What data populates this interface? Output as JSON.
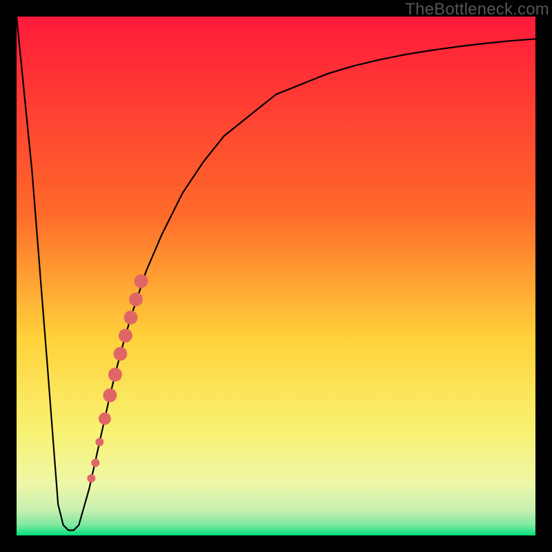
{
  "watermark": "TheBottleneck.com",
  "colors": {
    "frame": "#000000",
    "curve": "#000000",
    "marker": "#e06666",
    "top": "#ff1a3a",
    "mid1": "#ff6a2a",
    "mid2": "#ffd23a",
    "mid3": "#f8f272",
    "mid4": "#eef7a8",
    "bottom": "#00e07a"
  },
  "chart_data": {
    "type": "line",
    "title": "",
    "xlabel": "",
    "ylabel": "",
    "xlim": [
      0,
      100
    ],
    "ylim": [
      0,
      100
    ],
    "series": [
      {
        "name": "bottleneck-curve",
        "x": [
          0,
          3,
          6,
          8,
          9,
          10,
          11,
          12,
          14,
          16,
          18,
          20,
          22,
          25,
          28,
          32,
          36,
          40,
          45,
          50,
          55,
          60,
          65,
          70,
          75,
          80,
          85,
          90,
          95,
          100
        ],
        "y": [
          100,
          70,
          32,
          6,
          2,
          1,
          1,
          2,
          9,
          18,
          27,
          35,
          42,
          51,
          58,
          66,
          72,
          77,
          81,
          85,
          87,
          89,
          90.5,
          91.7,
          92.7,
          93.5,
          94.2,
          94.8,
          95.3,
          95.7
        ]
      }
    ],
    "markers": {
      "name": "highlighted-range",
      "x": [
        14.4,
        15.2,
        16.0,
        17.0,
        18.0,
        19.0,
        20.0,
        21.0,
        22.0,
        23.0,
        24.0
      ],
      "y": [
        11,
        14,
        18,
        22.5,
        27,
        31,
        35,
        38.5,
        42,
        45.5,
        49
      ],
      "size": [
        6,
        6,
        6,
        9,
        10,
        10,
        10,
        10,
        10,
        10,
        10
      ]
    }
  }
}
